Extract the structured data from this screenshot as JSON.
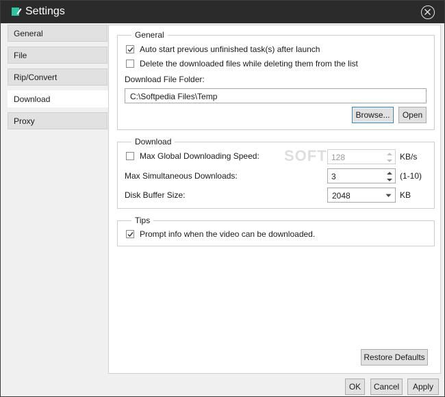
{
  "window": {
    "title": "Settings"
  },
  "sidebar": {
    "items": [
      {
        "label": "General"
      },
      {
        "label": "File"
      },
      {
        "label": "Rip/Convert"
      },
      {
        "label": "Download"
      },
      {
        "label": "Proxy"
      }
    ],
    "active": "Download"
  },
  "general": {
    "legend": "General",
    "auto_start_label": "Auto start previous unfinished task(s) after launch",
    "auto_start_checked": true,
    "delete_files_label": "Delete the downloaded files while deleting them from the list",
    "delete_files_checked": false,
    "folder_label": "Download File Folder:",
    "folder_value": "C:\\Softpedia Files\\Temp",
    "browse_label": "Browse...",
    "open_label": "Open"
  },
  "download": {
    "legend": "Download",
    "max_speed_label": "Max Global Downloading Speed:",
    "max_speed_checked": false,
    "max_speed_value": "128",
    "max_speed_unit": "KB/s",
    "max_simul_label": "Max Simultaneous Downloads:",
    "max_simul_value": "3",
    "max_simul_range": "(1-10)",
    "buffer_label": "Disk Buffer Size:",
    "buffer_value": "2048",
    "buffer_unit": "KB"
  },
  "tips": {
    "legend": "Tips",
    "prompt_label": "Prompt info when the video can be downloaded.",
    "prompt_checked": true
  },
  "watermark": "SOFTPEDIA",
  "buttons": {
    "restore": "Restore Defaults",
    "ok": "OK",
    "cancel": "Cancel",
    "apply": "Apply"
  },
  "colors": {
    "titlebar": "#2b2b2b",
    "accent": "#3c7fb1",
    "app_icon": "#2ec4a0"
  }
}
